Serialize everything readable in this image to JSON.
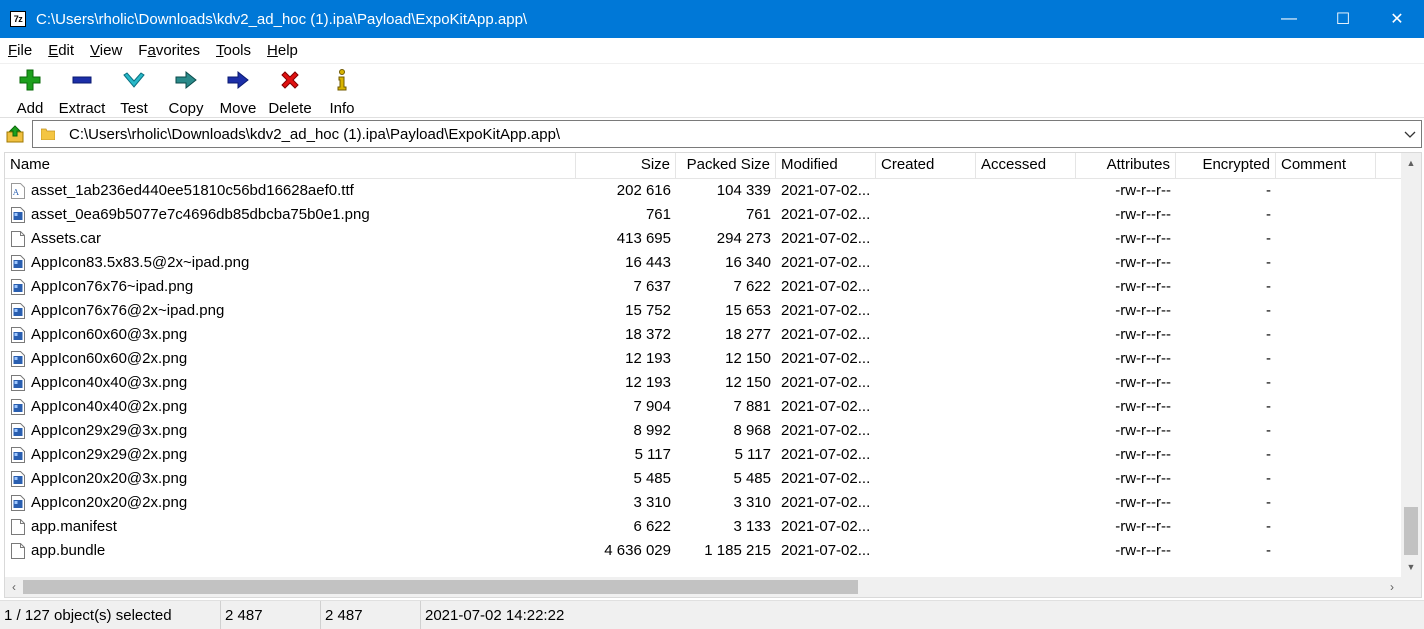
{
  "window": {
    "app_icon_text": "7z",
    "title": "C:\\Users\\rholic\\Downloads\\kdv2_ad_hoc (1).ipa\\Payload\\ExpoKitApp.app\\",
    "minimize": "—",
    "maximize": "☐",
    "close": "✕"
  },
  "menu": {
    "file": {
      "u": "F",
      "rest": "ile"
    },
    "edit": {
      "u": "E",
      "rest": "dit"
    },
    "view": {
      "u": "V",
      "rest": "iew"
    },
    "favorites_pre": "F",
    "favorites_u": "a",
    "favorites_rest": "vorites",
    "tools": {
      "u": "T",
      "rest": "ools"
    },
    "help": {
      "u": "H",
      "rest": "elp"
    }
  },
  "toolbar": {
    "add": "Add",
    "extract": "Extract",
    "test": "Test",
    "copy": "Copy",
    "move": "Move",
    "delete": "Delete",
    "info": "Info"
  },
  "address": {
    "path": "C:\\Users\\rholic\\Downloads\\kdv2_ad_hoc (1).ipa\\Payload\\ExpoKitApp.app\\"
  },
  "columns": {
    "name": "Name",
    "size": "Size",
    "packed": "Packed Size",
    "modified": "Modified",
    "created": "Created",
    "accessed": "Accessed",
    "attributes": "Attributes",
    "encrypted": "Encrypted",
    "comment": "Comment"
  },
  "files": [
    {
      "name": "asset_1ab236ed440ee51810c56bd16628aef0.ttf",
      "size": "202 616",
      "packed": "104 339",
      "modified": "2021-07-02...",
      "attr": "-rw-r--r--",
      "enc": "-",
      "type": "font"
    },
    {
      "name": "asset_0ea69b5077e7c4696db85dbcba75b0e1.png",
      "size": "761",
      "packed": "761",
      "modified": "2021-07-02...",
      "attr": "-rw-r--r--",
      "enc": "-",
      "type": "image"
    },
    {
      "name": "Assets.car",
      "size": "413 695",
      "packed": "294 273",
      "modified": "2021-07-02...",
      "attr": "-rw-r--r--",
      "enc": "-",
      "type": "file"
    },
    {
      "name": "AppIcon83.5x83.5@2x~ipad.png",
      "size": "16 443",
      "packed": "16 340",
      "modified": "2021-07-02...",
      "attr": "-rw-r--r--",
      "enc": "-",
      "type": "image"
    },
    {
      "name": "AppIcon76x76~ipad.png",
      "size": "7 637",
      "packed": "7 622",
      "modified": "2021-07-02...",
      "attr": "-rw-r--r--",
      "enc": "-",
      "type": "image"
    },
    {
      "name": "AppIcon76x76@2x~ipad.png",
      "size": "15 752",
      "packed": "15 653",
      "modified": "2021-07-02...",
      "attr": "-rw-r--r--",
      "enc": "-",
      "type": "image"
    },
    {
      "name": "AppIcon60x60@3x.png",
      "size": "18 372",
      "packed": "18 277",
      "modified": "2021-07-02...",
      "attr": "-rw-r--r--",
      "enc": "-",
      "type": "image"
    },
    {
      "name": "AppIcon60x60@2x.png",
      "size": "12 193",
      "packed": "12 150",
      "modified": "2021-07-02...",
      "attr": "-rw-r--r--",
      "enc": "-",
      "type": "image"
    },
    {
      "name": "AppIcon40x40@3x.png",
      "size": "12 193",
      "packed": "12 150",
      "modified": "2021-07-02...",
      "attr": "-rw-r--r--",
      "enc": "-",
      "type": "image"
    },
    {
      "name": "AppIcon40x40@2x.png",
      "size": "7 904",
      "packed": "7 881",
      "modified": "2021-07-02...",
      "attr": "-rw-r--r--",
      "enc": "-",
      "type": "image"
    },
    {
      "name": "AppIcon29x29@3x.png",
      "size": "8 992",
      "packed": "8 968",
      "modified": "2021-07-02...",
      "attr": "-rw-r--r--",
      "enc": "-",
      "type": "image"
    },
    {
      "name": "AppIcon29x29@2x.png",
      "size": "5 117",
      "packed": "5 117",
      "modified": "2021-07-02...",
      "attr": "-rw-r--r--",
      "enc": "-",
      "type": "image"
    },
    {
      "name": "AppIcon20x20@3x.png",
      "size": "5 485",
      "packed": "5 485",
      "modified": "2021-07-02...",
      "attr": "-rw-r--r--",
      "enc": "-",
      "type": "image"
    },
    {
      "name": "AppIcon20x20@2x.png",
      "size": "3 310",
      "packed": "3 310",
      "modified": "2021-07-02...",
      "attr": "-rw-r--r--",
      "enc": "-",
      "type": "image"
    },
    {
      "name": "app.manifest",
      "size": "6 622",
      "packed": "3 133",
      "modified": "2021-07-02...",
      "attr": "-rw-r--r--",
      "enc": "-",
      "type": "file"
    },
    {
      "name": "app.bundle",
      "size": "4 636 029",
      "packed": "1 185 215",
      "modified": "2021-07-02...",
      "attr": "-rw-r--r--",
      "enc": "-",
      "type": "file"
    }
  ],
  "status": {
    "selection": "1 / 127 object(s) selected",
    "size": "2 487",
    "packed": "2 487",
    "modified": "2021-07-02 14:22:22"
  },
  "colors": {
    "titlebar": "#0078d7",
    "add_icon": "#1ea01e",
    "extract_icon": "#1c2fa8",
    "test_icon": "#28b8c8",
    "copy_icon": "#2a8a8a",
    "move_icon": "#1c2fa8",
    "delete_icon": "#e01010",
    "info_icon": "#d8b400"
  }
}
